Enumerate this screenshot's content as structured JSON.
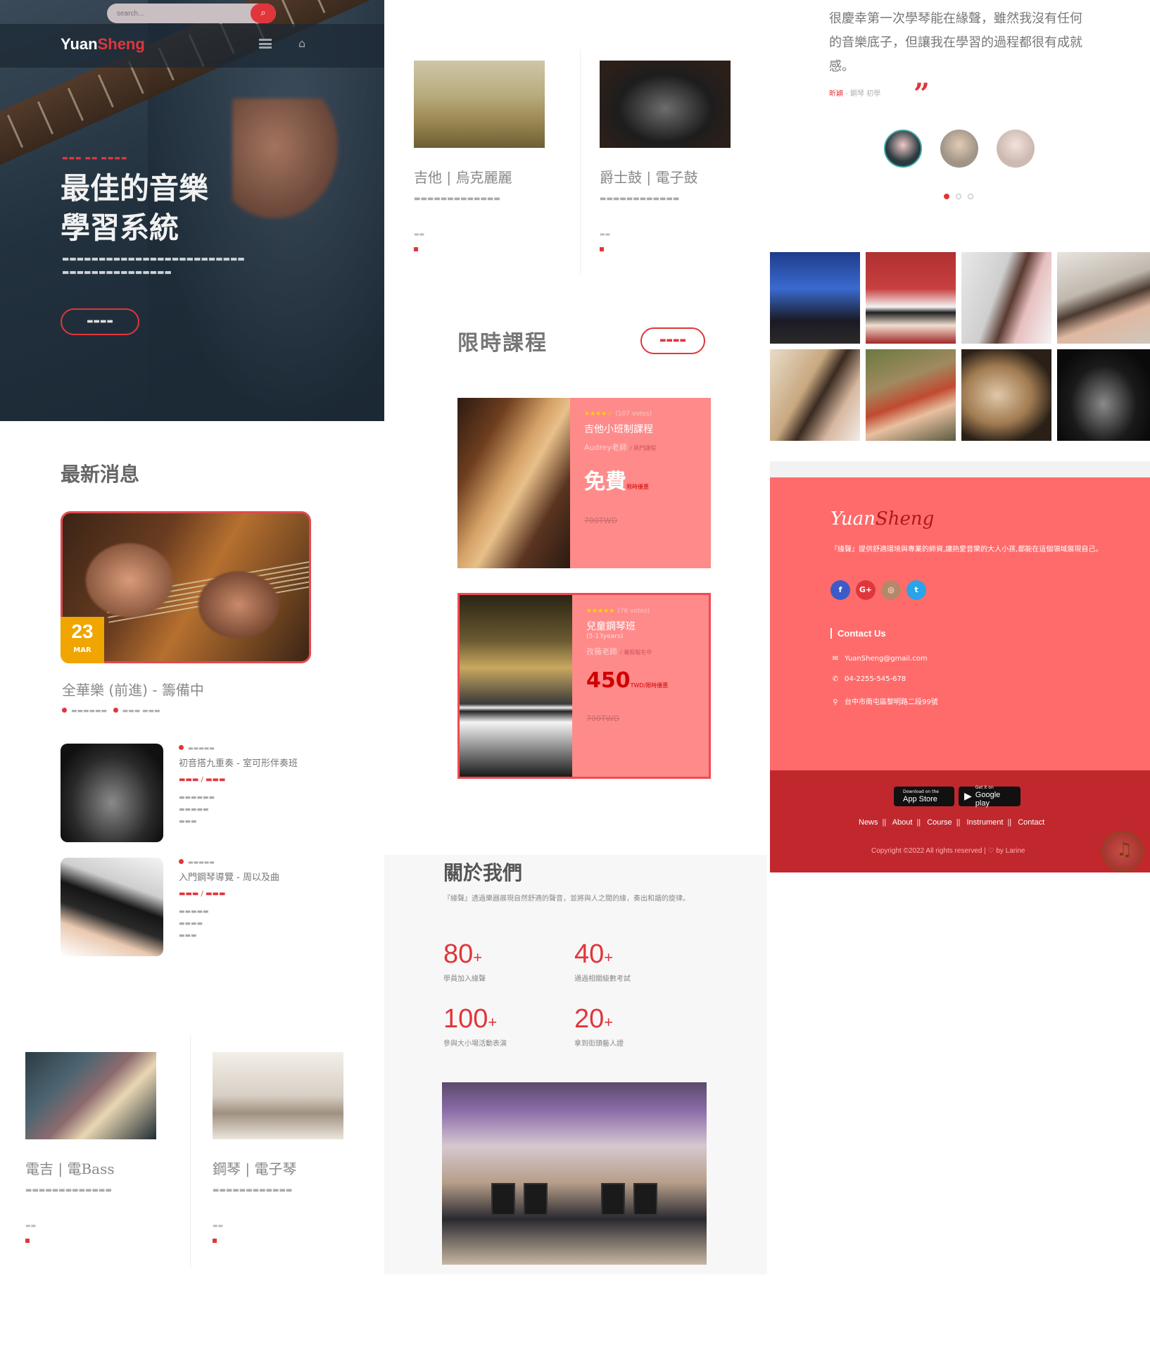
{
  "hero": {
    "search_placeholder": "search...",
    "search_icon": "search-icon",
    "logo_a": "Yuan",
    "logo_b": "Sheng",
    "menu_icon": "menu-icon",
    "home_icon": "home-icon",
    "title": "最佳的音樂\n學習系統"
  },
  "news": {
    "title": "最新消息",
    "feature": {
      "day": "23",
      "month": "MAR",
      "headline": "全華樂 (前進) - 籌備中"
    },
    "items": [
      {
        "title": "初音搭九重奏 - 室可形伴奏班"
      },
      {
        "title": "入門鋼琴導覽 - 周以及曲"
      }
    ]
  },
  "instruments": [
    {
      "title": "吉他 | 烏克麗麗"
    },
    {
      "title": "爵士鼓 | 電子鼓"
    },
    {
      "title": "電吉 | 電Bass"
    },
    {
      "title": "鋼琴 | 電子琴"
    }
  ],
  "courses": {
    "title": "限時課程",
    "cards": [
      {
        "votes": "(107 votes)",
        "name": "吉他小班制課程",
        "teacher": "Audrey老師",
        "tag": "/ 熱門課程",
        "price": "免費",
        "unit": "限時優惠",
        "old_price": "700TWD"
      },
      {
        "votes": "(76 votes)",
        "name": "兒童鋼琴班",
        "sub": "(5-13years)",
        "teacher": "孜薇老師",
        "tag": "/ 暑假報名中",
        "price": "450",
        "unit": "TWD/限時優惠",
        "old_price": "700TWD"
      }
    ]
  },
  "about": {
    "title": "關於我們",
    "desc": "『緣聲』透過樂器展現自然舒適的聲音，並將與人之間的緣，奏出和諧的旋律。",
    "stats": [
      {
        "num": "80",
        "label": "學員加入緣聲"
      },
      {
        "num": "40",
        "label": "通過相關級數考試"
      },
      {
        "num": "100",
        "label": "參與大小場活動表演"
      },
      {
        "num": "20",
        "label": "拿到街頭藝人證"
      }
    ]
  },
  "testimonial": {
    "quote": "很慶幸第一次學琴能在緣聲，雖然我沒有任何的音樂底子，但讓我在學習的過程都很有成就感。",
    "author": "昕穎",
    "role": "- 鋼琴 初學"
  },
  "footer": {
    "logo_a": "Yuan",
    "logo_b": "Sheng",
    "desc": "『緣聲』提供舒適環境與專業的師資,讓熱愛音樂的大人小孩,都能在這個領域展現自己。",
    "social": {
      "fb": "f",
      "gp": "G+",
      "ig": "◎",
      "tw": "t"
    },
    "contact_title": "Contact Us",
    "email": "YuanSheng@gmail.com",
    "phone": "04-2255-545-678",
    "address": "台中市南屯區黎明路二段99號",
    "apple_small": "Download on the",
    "apple_big": "App Store",
    "google_small": "Get it on",
    "google_big": "Google play",
    "nav": [
      "News",
      "About",
      "Course",
      "Instrument",
      "Contact"
    ],
    "copyright": "Copyright ©2022 All rights reserved | ♡ by Larine"
  }
}
